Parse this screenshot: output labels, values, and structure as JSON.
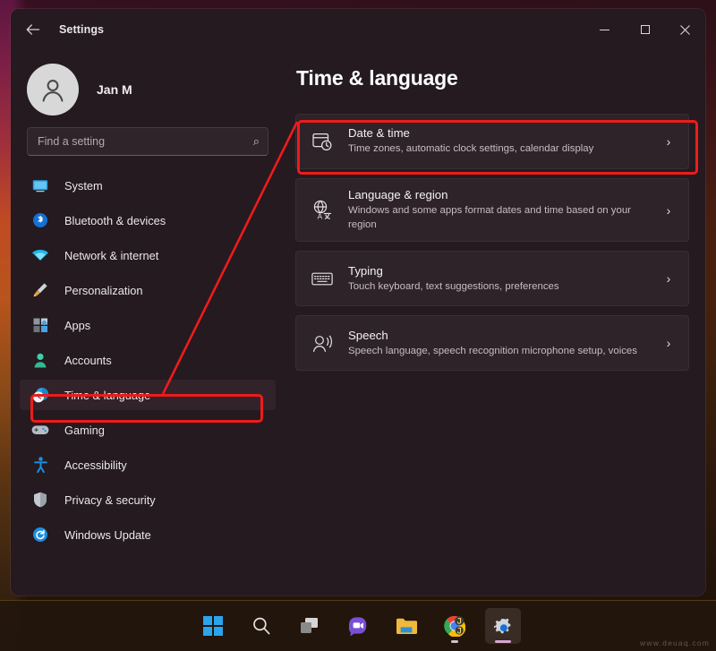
{
  "window": {
    "title": "Settings",
    "back_icon": "back-arrow-icon",
    "minimize_label": "Minimize",
    "maximize_label": "Maximize",
    "close_label": "Close"
  },
  "profile": {
    "name": "Jan M",
    "avatar_icon": "person-avatar-icon"
  },
  "search": {
    "value": "",
    "placeholder": "Find a setting",
    "icon": "search-icon"
  },
  "sidebar": {
    "items": [
      {
        "label": "System",
        "icon": "monitor-icon",
        "active": false
      },
      {
        "label": "Bluetooth & devices",
        "icon": "bluetooth-icon",
        "active": false
      },
      {
        "label": "Network & internet",
        "icon": "wifi-icon",
        "active": false
      },
      {
        "label": "Personalization",
        "icon": "paintbrush-icon",
        "active": false
      },
      {
        "label": "Apps",
        "icon": "apps-grid-icon",
        "active": false
      },
      {
        "label": "Accounts",
        "icon": "account-person-icon",
        "active": false
      },
      {
        "label": "Time & language",
        "icon": "clock-globe-icon",
        "active": true
      },
      {
        "label": "Gaming",
        "icon": "gamepad-icon",
        "active": false
      },
      {
        "label": "Accessibility",
        "icon": "accessibility-icon",
        "active": false
      },
      {
        "label": "Privacy & security",
        "icon": "shield-icon",
        "active": false
      },
      {
        "label": "Windows Update",
        "icon": "update-refresh-icon",
        "active": false
      }
    ]
  },
  "main": {
    "page_title": "Time & language",
    "cards": [
      {
        "title": "Date & time",
        "subtitle": "Time zones, automatic clock settings, calendar display",
        "icon": "calendar-clock-icon",
        "chevron": "chevron-right-icon",
        "highlighted": true
      },
      {
        "title": "Language & region",
        "subtitle": "Windows and some apps format dates and time based on your region",
        "icon": "globe-language-icon",
        "chevron": "chevron-right-icon",
        "highlighted": false
      },
      {
        "title": "Typing",
        "subtitle": "Touch keyboard, text suggestions, preferences",
        "icon": "keyboard-icon",
        "chevron": "chevron-right-icon",
        "highlighted": false
      },
      {
        "title": "Speech",
        "subtitle": "Speech language, speech recognition microphone setup, voices",
        "icon": "speech-microphone-icon",
        "chevron": "chevron-right-icon",
        "highlighted": false
      }
    ]
  },
  "annotations": {
    "accent_color": "#ef1b1b",
    "highlight_targets": [
      "Time & language",
      "Date & time"
    ]
  },
  "taskbar": {
    "items": [
      {
        "name": "start-button",
        "label": "Start",
        "running": false,
        "underline": "none"
      },
      {
        "name": "search-button",
        "label": "Search",
        "running": false,
        "underline": "none"
      },
      {
        "name": "task-view-button",
        "label": "Task view",
        "running": false,
        "underline": "none"
      },
      {
        "name": "chat-button",
        "label": "Chat",
        "running": false,
        "underline": "none"
      },
      {
        "name": "file-explorer-button",
        "label": "File Explorer",
        "running": false,
        "underline": "none"
      },
      {
        "name": "chrome-button",
        "label": "Google Chrome",
        "running": true,
        "underline": "small"
      },
      {
        "name": "settings-button",
        "label": "Settings",
        "running": true,
        "underline": "wide"
      }
    ]
  },
  "watermark": {
    "text": "www.deuaq.com"
  }
}
